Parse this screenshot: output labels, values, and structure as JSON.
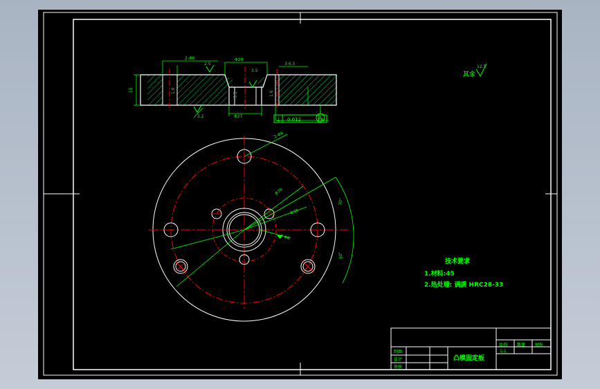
{
  "colors": {
    "background": "#000000",
    "border": "#ffffff",
    "part_outline": "#ffffff",
    "center_lines": "#ff0000",
    "dimensions": "#00ff00",
    "hatch": "#00cc66"
  },
  "section_view": {
    "dims": {
      "holes_callout": "2-Φ6",
      "hole_depth": "2.5",
      "center_bore": "Φ20",
      "chamfer_left": "3.5",
      "chamfer_right": "3-6.5",
      "height": "15",
      "inner_depth": "5.5",
      "step": "1.6",
      "bottom_left": "3.2",
      "bottom_bore": "Φ27",
      "right_depth": "1.6"
    },
    "tolerance_symbol": "⊥",
    "tolerance_value": "0.012",
    "tolerance_datum": "A",
    "datum_label": "A"
  },
  "plan_view": {
    "dims": {
      "holes_callout": "2-Φ6",
      "pcd_outer": "Φ70",
      "pcd_inner": "Φ38",
      "bore": "Φ8",
      "angle_upper": "30°",
      "angle_lower": "30°"
    }
  },
  "roughness": {
    "label": "其余",
    "value": "12.5"
  },
  "tech_requirements": {
    "title": "技术要求",
    "lines": [
      "1.材料:45",
      "2.热处理: 调质 HRC28-33"
    ]
  },
  "title_block": {
    "part_name": "凸模固定板",
    "headers": [
      "比例",
      "数量",
      "材料"
    ],
    "scale": "1:1",
    "rows": [
      "制图",
      "设计",
      "审核"
    ]
  }
}
